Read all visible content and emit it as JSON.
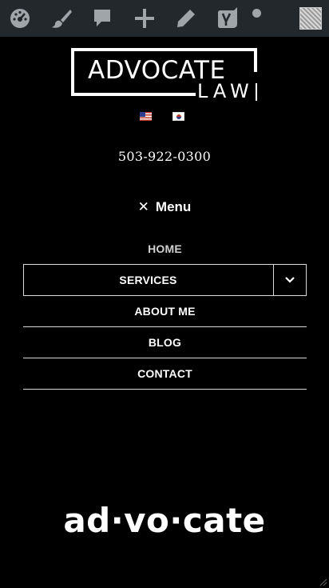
{
  "adminbar": {
    "icons": [
      "dashboard-icon",
      "customize-brush-icon",
      "comment-icon",
      "add-new-icon",
      "edit-icon",
      "yoast-seo-icon",
      "notification-dot-icon",
      "user-avatar"
    ],
    "background": "#23282d",
    "icon_color": "#a0a5aa"
  },
  "logo": {
    "title": "ADVOCATE",
    "subtitle": "LAW"
  },
  "languages": [
    {
      "flag": "us-flag-icon"
    },
    {
      "flag": "kr-flag-icon"
    }
  ],
  "phone": "503-922-0300",
  "menu": {
    "toggle_label": "Menu",
    "items": [
      {
        "label": "HOME"
      },
      {
        "label": "SERVICES",
        "has_submenu": true
      },
      {
        "label": "ABOUT ME"
      },
      {
        "label": "BLOG"
      },
      {
        "label": "CONTACT"
      }
    ]
  },
  "tagline": "ad·vo·cate",
  "colors": {
    "background": "#000000",
    "text": "#ffffff",
    "divider": "#d9d9d9"
  }
}
